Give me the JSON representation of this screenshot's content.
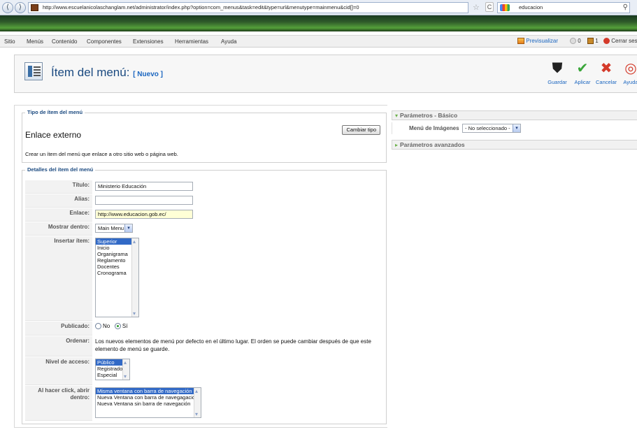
{
  "browser": {
    "url": "http://www.escuelanicolaschanglam.net/administrator/index.php?option=com_menus&task=edit&type=url&menutype=mainmenu&cid[]=0",
    "search_query": "educacion",
    "back_glyph": "⟨",
    "forward_glyph": "⟩",
    "star_glyph": "☆",
    "reload_glyph": "C",
    "search_glyph": "⚲"
  },
  "topmenu": {
    "items": [
      "Sitio",
      "Menús",
      "Contenido",
      "Componentes",
      "Extensiones",
      "Herramientas",
      "Ayuda"
    ],
    "preview_label": "Previsualizar",
    "messages_count": "0",
    "users_count": "1",
    "logout_label": "Cerrar sesi"
  },
  "toolbar": {
    "title": "Ítem del menú:",
    "title_sub": "[ Nuevo ]",
    "buttons": [
      {
        "label": "Guardar",
        "icon": "save-icon",
        "glyph": "⛊",
        "color": "#222222"
      },
      {
        "label": "Aplicar",
        "icon": "apply-icon",
        "glyph": "✔",
        "color": "#3aa63a"
      },
      {
        "label": "Cancelar",
        "icon": "cancel-icon",
        "glyph": "✖",
        "color": "#d43a2a"
      },
      {
        "label": "Ayuda",
        "icon": "help-icon",
        "glyph": "◎",
        "color": "#d43a2a"
      }
    ]
  },
  "menu_type": {
    "legend": "Tipo de ítem del menú",
    "name": "Enlace externo",
    "description": "Crear un ítem del menú que enlace a otro sitio web o página web.",
    "change_button": "Cambiar tipo"
  },
  "details": {
    "legend": "Detalles del ítem del menú",
    "title_label": "Título:",
    "title_value": "Ministerio Educación",
    "alias_label": "Alias:",
    "alias_value": "",
    "link_label": "Enlace:",
    "link_value": "http://www.educacion.gob.ec/",
    "display_in_label": "Mostrar dentro:",
    "display_in_value": "Main Menu",
    "parent_label": "Insertar ítem:",
    "parent_options": [
      "Superior",
      "Inicio",
      "Organigrama",
      "Reglamento",
      "Docentes",
      "Cronograma"
    ],
    "published_label": "Publicado:",
    "published_no": "No",
    "published_yes": "Sí",
    "order_label": "Ordenar:",
    "order_text": "Los nuevos elementos de menú por defecto en el último lugar. El orden se puede cambiar después de que este elemento de menú se guarde.",
    "access_label": "Nivel de acceso:",
    "access_options": [
      "Público",
      "Registrado",
      "Especial"
    ],
    "on_click_label": "Al hacer click, abrir dentro:",
    "on_click_options": [
      "Misma ventana con barra de navegación",
      "Nueva Ventana con barra de navegagación",
      "Nueva Ventana sin barra de navegación"
    ]
  },
  "params": {
    "basic_title": "Parámetros - Básico",
    "image_menu_label": "Menú de Imágenes",
    "image_menu_value": "- No seleccionado -",
    "advanced_title": "Parámetros avanzados"
  }
}
